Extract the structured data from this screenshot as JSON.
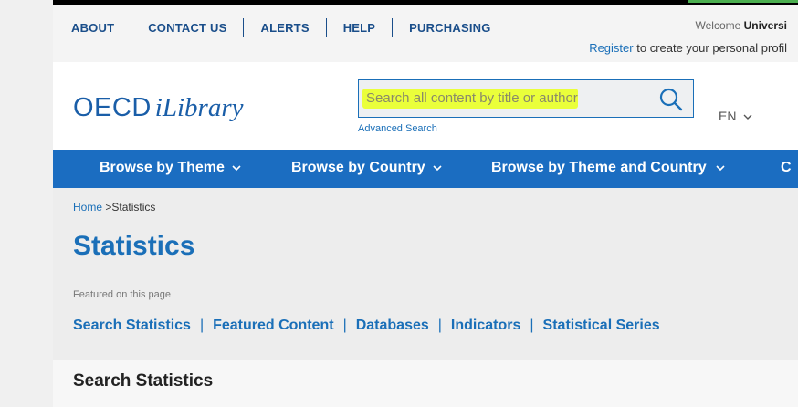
{
  "utility_nav": [
    "ABOUT",
    "CONTACT US",
    "ALERTS",
    "HELP",
    "PURCHASING"
  ],
  "welcome": {
    "prefix": "Welcome",
    "name": "Universi"
  },
  "register": {
    "link": "Register",
    "text": "to create your personal profil"
  },
  "logo": {
    "part1": "OECD",
    "part2": "iLibrary"
  },
  "search": {
    "placeholder": "Search all content by title or author",
    "icon": "search-icon",
    "advanced": "Advanced Search",
    "highlight_color": "#eaff3a"
  },
  "language": {
    "label": "EN",
    "icon": "chevron-down-icon"
  },
  "main_nav": [
    "Browse by Theme",
    "Browse by Country",
    "Browse by Theme and Country",
    "C"
  ],
  "breadcrumb": {
    "home": "Home",
    "separator": ">",
    "current": "Statistics"
  },
  "page_title": "Statistics",
  "featured_label": "Featured on this page",
  "featured_links": [
    "Search Statistics",
    "Featured Content",
    "Databases",
    "Indicators",
    "Statistical Series"
  ],
  "section_title": "Search Statistics",
  "colors": {
    "brand": "#1a6fb8",
    "nav_bg": "#1b6dc1"
  }
}
